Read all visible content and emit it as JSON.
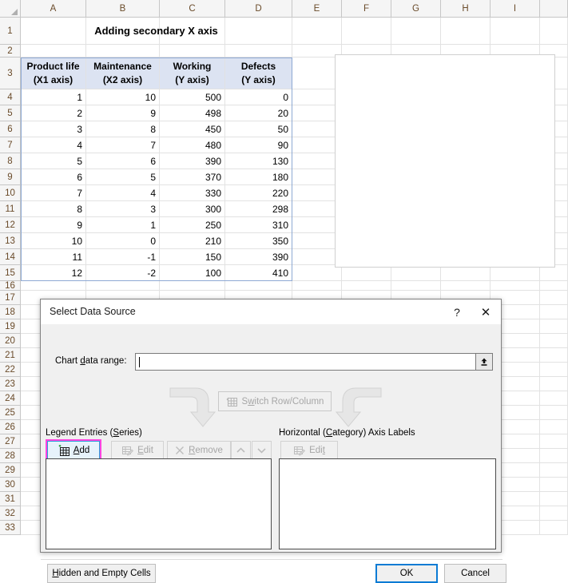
{
  "app": {
    "name": "Excel Spreadsheet"
  },
  "sheet": {
    "columns": [
      "A",
      "B",
      "C",
      "D",
      "E",
      "F",
      "G",
      "H",
      "I"
    ],
    "row_numbers": [
      1,
      2,
      3,
      4,
      5,
      6,
      7,
      8,
      9,
      10,
      11,
      12,
      13,
      14,
      15,
      16,
      17,
      18,
      19,
      20,
      21,
      22,
      23,
      24,
      25,
      26,
      27,
      28,
      29,
      30,
      31,
      32,
      33
    ],
    "title_cell": "Adding secondary X axis",
    "header_row": [
      {
        "line1": "Product life",
        "line2": "(X1 axis)"
      },
      {
        "line1": "Maintenance",
        "line2": "(X2 axis)"
      },
      {
        "line1": "Working",
        "line2": "(Y axis)"
      },
      {
        "line1": "Defects",
        "line2": "(Y axis)"
      }
    ],
    "data_rows": [
      [
        "1",
        "10",
        "500",
        "0"
      ],
      [
        "2",
        "9",
        "498",
        "20"
      ],
      [
        "3",
        "8",
        "450",
        "50"
      ],
      [
        "4",
        "7",
        "480",
        "90"
      ],
      [
        "5",
        "6",
        "390",
        "130"
      ],
      [
        "6",
        "5",
        "370",
        "180"
      ],
      [
        "7",
        "4",
        "330",
        "220"
      ],
      [
        "8",
        "3",
        "300",
        "298"
      ],
      [
        "9",
        "1",
        "250",
        "310"
      ],
      [
        "10",
        "0",
        "210",
        "350"
      ],
      [
        "11",
        "-1",
        "150",
        "390"
      ],
      [
        "12",
        "-2",
        "100",
        "410"
      ]
    ],
    "header_fill": "#dce3f2",
    "table_outline": "#8ea9d3"
  },
  "chart_data": {
    "type": "table",
    "title": "Adding secondary X axis",
    "columns": [
      "Product life (X1 axis)",
      "Maintenance (X2 axis)",
      "Working (Y axis)",
      "Defects (Y axis)"
    ],
    "x": [
      1,
      2,
      3,
      4,
      5,
      6,
      7,
      8,
      9,
      10,
      11,
      12
    ],
    "series": [
      {
        "name": "Maintenance (X2 axis)",
        "values": [
          10,
          9,
          8,
          7,
          6,
          5,
          4,
          3,
          1,
          0,
          -1,
          -2
        ]
      },
      {
        "name": "Working (Y axis)",
        "values": [
          500,
          498,
          450,
          480,
          390,
          370,
          330,
          300,
          250,
          210,
          150,
          100
        ]
      },
      {
        "name": "Defects (Y axis)",
        "values": [
          0,
          20,
          50,
          90,
          130,
          180,
          220,
          298,
          310,
          350,
          390,
          410
        ]
      }
    ],
    "xlabel": "Product life (X1 axis)",
    "ylabel": "",
    "grid": true,
    "legend": "none",
    "note": "Empty chart plot area placeholder rendered over columns E-I; no series plotted yet."
  },
  "dialog": {
    "title": "Select Data Source",
    "help_icon": "?",
    "close_icon": "✕",
    "chart_data_range": {
      "label_pre": "Chart ",
      "label_accel": "d",
      "label_post": "ata range:",
      "value": "",
      "placeholder": "",
      "picker_icon": "range-select-icon"
    },
    "switch_button": {
      "pre": "S",
      "accel": "w",
      "post": "itch Row/Column",
      "enabled": false
    },
    "legend_panel": {
      "heading_pre": "Legend Entries (",
      "heading_accel": "S",
      "heading_post": "eries)",
      "buttons": [
        {
          "name": "add",
          "pre": "",
          "accel": "A",
          "post": "dd",
          "state": "highlighted"
        },
        {
          "name": "edit",
          "pre": "",
          "accel": "E",
          "post": "dit",
          "state": "disabled"
        },
        {
          "name": "remove",
          "pre": "",
          "accel": "R",
          "post": "emove",
          "state": "disabled"
        },
        {
          "name": "move-up",
          "glyph": "▲",
          "state": "disabled"
        },
        {
          "name": "move-down",
          "glyph": "▼",
          "state": "disabled"
        }
      ],
      "items": []
    },
    "category_panel": {
      "heading_pre": "Horizontal (",
      "heading_accel": "C",
      "heading_post": "ategory) Axis Labels",
      "edit_button": {
        "pre": "Edi",
        "accel": "t",
        "post": "",
        "state": "disabled"
      },
      "items": []
    },
    "footer": {
      "hidden_cells": {
        "pre": "",
        "accel": "H",
        "post": "idden and Empty Cells"
      },
      "ok": "OK",
      "cancel": "Cancel"
    },
    "highlight_color": "#ff45e0",
    "focus_color": "#0a7bd4"
  }
}
